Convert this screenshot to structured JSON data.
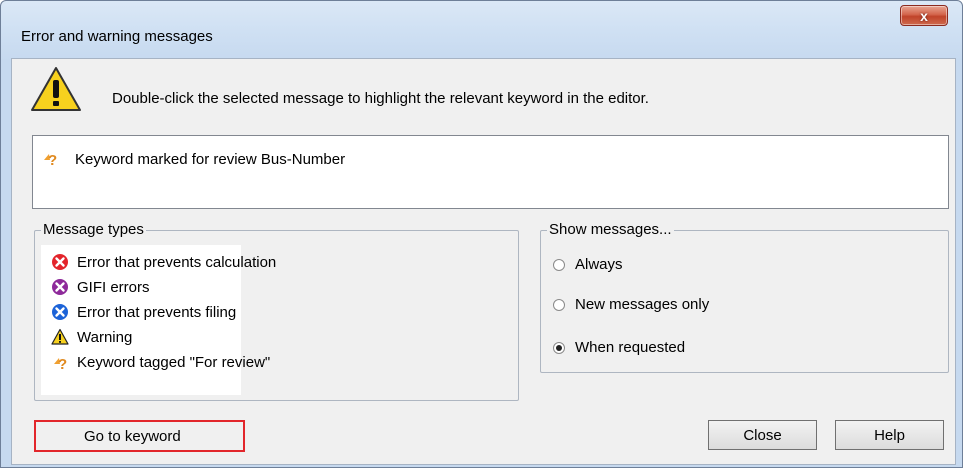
{
  "window": {
    "title": "Error and warning messages",
    "close_glyph": "x"
  },
  "header": {
    "icon": "warning-icon",
    "instruction": "Double-click the selected message to highlight the relevant keyword in the editor."
  },
  "messages": [
    {
      "icon": "review-icon",
      "text": "Keyword marked for review Bus-Number"
    }
  ],
  "message_types": {
    "label": "Message types",
    "items": [
      {
        "icon": "error-calc-icon",
        "color": "#e3242b",
        "text": "Error that prevents calculation"
      },
      {
        "icon": "gifi-error-icon",
        "color": "#8e2a9a",
        "text": "GIFI errors"
      },
      {
        "icon": "error-filing-icon",
        "color": "#1c63d8",
        "text": "Error that prevents filing"
      },
      {
        "icon": "warning-icon",
        "color": "#f7d11e",
        "text": "Warning"
      },
      {
        "icon": "review-icon",
        "color": "#f0a030",
        "text": "Keyword tagged \"For review\""
      }
    ]
  },
  "show_messages": {
    "label": "Show messages...",
    "options": [
      {
        "label": "Always",
        "checked": false
      },
      {
        "label": "New messages only",
        "checked": false
      },
      {
        "label": "When requested",
        "checked": true
      }
    ]
  },
  "buttons": {
    "goto": "Go to keyword",
    "close": "Close",
    "help": "Help"
  },
  "colors": {
    "highlight": "#e2262b",
    "error_red": "#e3242b",
    "gifi_purple": "#8e2a9a",
    "filing_blue": "#1c63d8",
    "warning_yellow": "#f7d11e"
  }
}
